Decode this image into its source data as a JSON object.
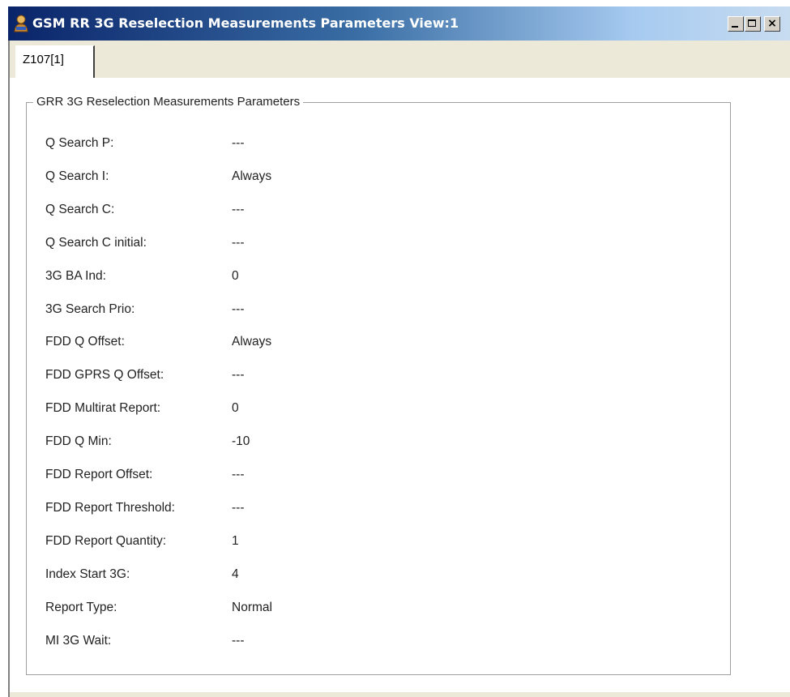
{
  "window": {
    "title": "GSM RR 3G Reselection Measurements Parameters View:1",
    "controls": [
      "minimize-icon",
      "maximize-icon",
      "close-icon"
    ]
  },
  "tab": {
    "label": "Z107[1]"
  },
  "group": {
    "title": "GRR 3G Reselection Measurements Parameters",
    "rows": [
      {
        "label": "Q Search P:",
        "value": "---"
      },
      {
        "label": "Q Search I:",
        "value": "Always"
      },
      {
        "label": "Q Search C:",
        "value": "---"
      },
      {
        "label": "Q Search C initial:",
        "value": "---"
      },
      {
        "label": "3G BA Ind:",
        "value": "0"
      },
      {
        "label": "3G Search Prio:",
        "value": "---"
      },
      {
        "label": "FDD Q Offset:",
        "value": "Always"
      },
      {
        "label": "FDD GPRS Q Offset:",
        "value": "---"
      },
      {
        "label": "FDD Multirat Report:",
        "value": "0"
      },
      {
        "label": "FDD Q Min:",
        "value": "-10"
      },
      {
        "label": "FDD Report Offset:",
        "value": "---"
      },
      {
        "label": "FDD Report Threshold:",
        "value": "---"
      },
      {
        "label": "FDD Report Quantity:",
        "value": "1"
      },
      {
        "label": "Index Start 3G:",
        "value": "4"
      },
      {
        "label": "Report Type:",
        "value": "Normal"
      },
      {
        "label": "MI 3G Wait:",
        "value": "---"
      }
    ]
  }
}
